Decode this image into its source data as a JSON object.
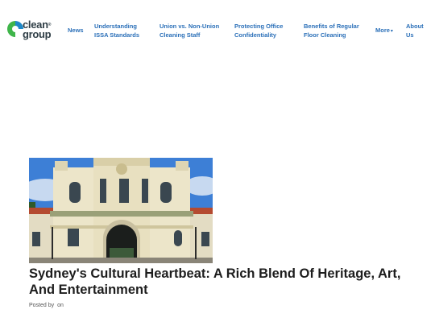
{
  "logo": {
    "line1": "clean",
    "line2": "group",
    "trademark": "®",
    "colors": {
      "green": "#3fb54a",
      "blue": "#1e88c8",
      "text": "#2f3e46"
    }
  },
  "nav": {
    "items": [
      {
        "label": "News"
      },
      {
        "label": "Understanding ISSA Standards"
      },
      {
        "label": "Union vs. Non-Union Cleaning Staff"
      },
      {
        "label": "Protecting Office Confidentiality"
      },
      {
        "label": "Benefits of Regular Floor Cleaning"
      },
      {
        "label": "More"
      },
      {
        "label": "About Us"
      }
    ],
    "more_icon": "chevron-down-icon",
    "link_color": "#2a6fb8"
  },
  "post": {
    "image_icon": "sydney-town-hall-photo",
    "title": "Sydney's Cultural Heartbeat: A Rich Blend Of Heritage, Art, And Entertainment",
    "posted_by_label": "Posted by",
    "posted_on_label": "on"
  }
}
